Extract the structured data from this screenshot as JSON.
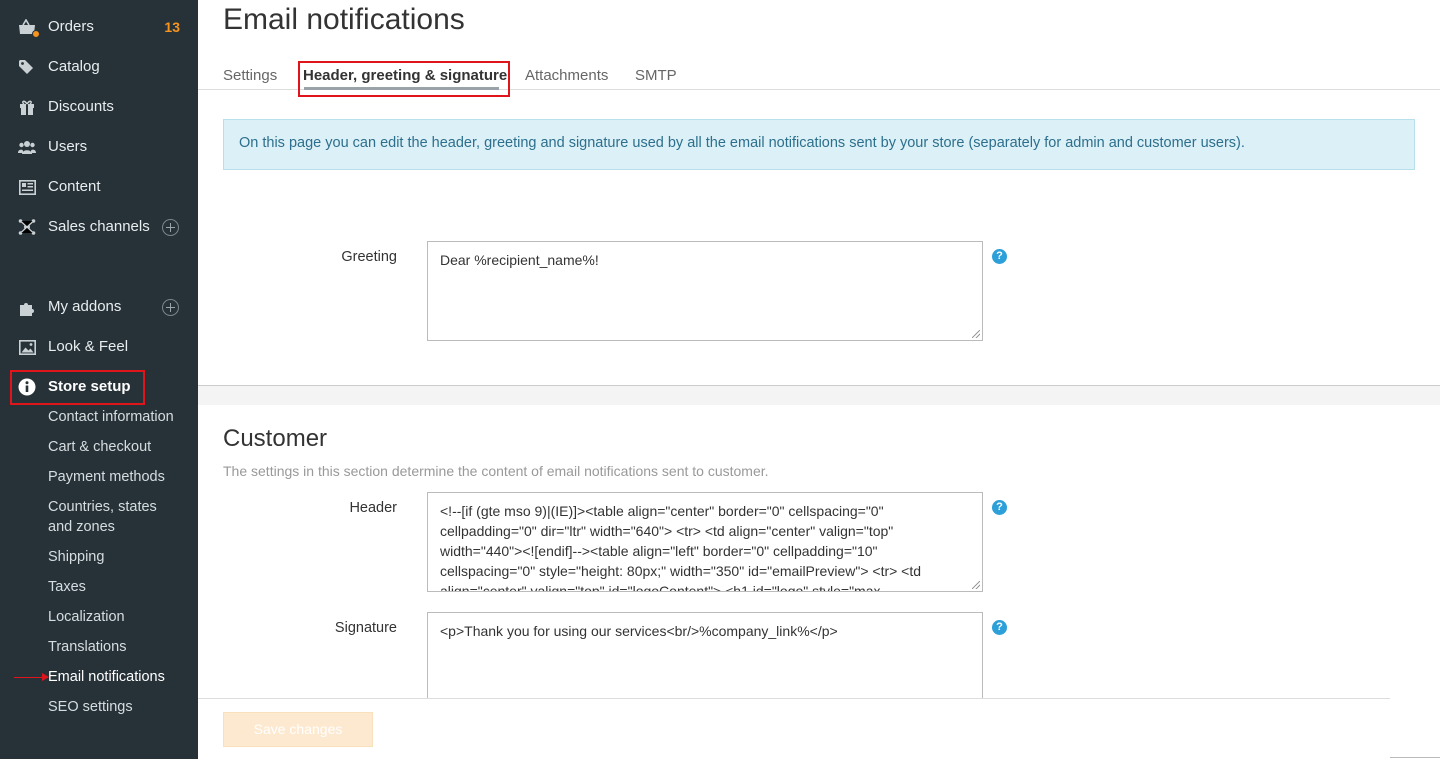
{
  "sidebar": {
    "items": [
      {
        "label": "Orders",
        "icon": "orders-icon",
        "badge": "13"
      },
      {
        "label": "Catalog",
        "icon": "tag-icon"
      },
      {
        "label": "Discounts",
        "icon": "gift-icon"
      },
      {
        "label": "Users",
        "icon": "users-icon"
      },
      {
        "label": "Content",
        "icon": "content-icon"
      },
      {
        "label": "Sales channels",
        "icon": "network-icon"
      },
      {
        "label": "My addons",
        "icon": "puzzle-icon"
      },
      {
        "label": "Look & Feel",
        "icon": "image-icon"
      },
      {
        "label": "Store setup",
        "icon": "info-icon"
      }
    ],
    "store_setup_sub": [
      "Contact information",
      "Cart & checkout",
      "Payment methods",
      "Countries, states",
      "and zones",
      "Shipping",
      "Taxes",
      "Localization",
      "Translations",
      "Email notifications",
      "SEO settings"
    ]
  },
  "page": {
    "title": "Email notifications",
    "tabs": [
      "Settings",
      "Header, greeting & signature",
      "Attachments",
      "SMTP"
    ],
    "active_tab": "Header, greeting & signature",
    "info_text": "On this page you can edit the header, greeting and signature used by all the email notifications sent by your store (separately for admin and customer users).",
    "greeting_label": "Greeting",
    "greeting_value": "Dear %recipient_name%!",
    "customer": {
      "title": "Customer",
      "description": "The settings in this section determine the content of email notifications sent to customer.",
      "header_label": "Header",
      "header_value": "<!--[if (gte mso 9)|(IE)]><table align=\"center\" border=\"0\" cellspacing=\"0\" cellpadding=\"0\" dir=\"ltr\" width=\"640\">  <tr>    <td align=\"center\" valign=\"top\" width=\"440\"><![endif]--><table align=\"left\" border=\"0\" cellpadding=\"10\" cellspacing=\"0\" style=\"height: 80px;\" width=\"350\" id=\"emailPreview\">  <tr>    <td align=\"center\" valign=\"top\" id=\"logoContent\">      <h1 id=\"logo\" style=\"max-",
      "signature_label": "Signature",
      "signature_value": "<p>Thank you for using our services<br/>%company_link%</p>"
    },
    "help_glyph": "?",
    "save_label": "Save changes"
  },
  "colors": {
    "sidebar_bg": "#263238",
    "accent_orange": "#f7941d",
    "highlight_red": "#e0141b",
    "info_bg": "#dbf0f7",
    "help_blue": "#2d9fd9"
  }
}
